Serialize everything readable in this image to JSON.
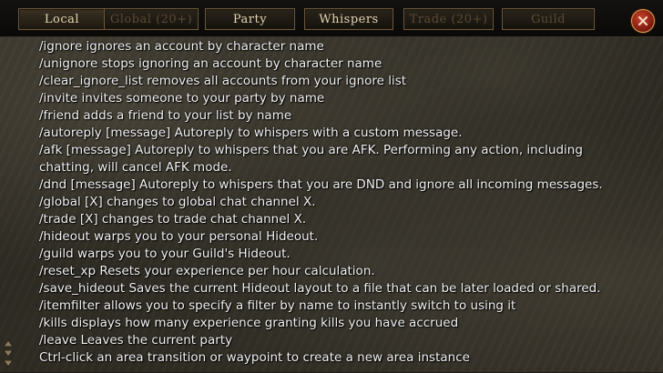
{
  "tabs": [
    {
      "label": "Local",
      "state": "active"
    },
    {
      "label": "Global (20+)",
      "state": "dim"
    },
    {
      "label": "Party",
      "state": "normal"
    },
    {
      "label": "Whispers",
      "state": "normal"
    },
    {
      "label": "Trade (20+)",
      "state": "dim"
    },
    {
      "label": "Guild",
      "state": "dim"
    }
  ],
  "close_icon": "close-icon",
  "chat_lines": [
    "/ignore ignores an account by character name",
    "/unignore stops ignoring an account by character name",
    "/clear_ignore_list removes all accounts from your ignore list",
    "/invite invites someone to your party by name",
    "/friend adds a friend to your list by name",
    "/autoreply [message] Autoreply to whispers with a custom message.",
    "/afk [message] Autoreply to whispers that you are AFK. Performing any action, including chatting, will cancel AFK mode.",
    "/dnd [message] Autoreply to whispers that you are DND and ignore all incoming messages.",
    "/global [X] changes to global chat channel X.",
    "/trade [X] changes to trade chat channel X.",
    "/hideout warps you to your personal Hideout.",
    "/guild warps you to your Guild's Hideout.",
    "/reset_xp Resets your experience per hour calculation.",
    "/save_hideout Saves the current Hideout layout to a file that can be later loaded or shared.",
    "/itemfilter allows you to specify a filter by name to instantly switch to using it",
    "/kills displays how many experience granting kills you have accrued",
    "/leave Leaves the current party",
    "Ctrl-click an area transition or waypoint to create a new area instance"
  ],
  "colors": {
    "tab_text": "#e4d6b4",
    "tab_text_dim": "#5a4a34",
    "tab_border": "#6b5a3c",
    "chat_text": "#f2f2f2",
    "close_button": "#b0301e"
  }
}
